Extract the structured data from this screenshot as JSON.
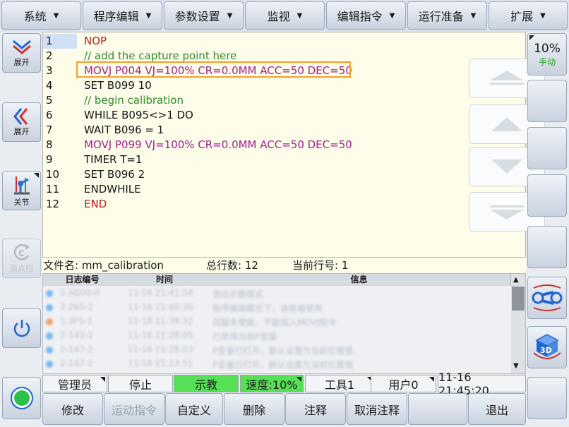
{
  "top_menu": [
    {
      "label": "系统"
    },
    {
      "label": "程序编辑"
    },
    {
      "label": "参数设置"
    },
    {
      "label": "监视"
    },
    {
      "label": "编辑指令"
    },
    {
      "label": "运行准备"
    },
    {
      "label": "扩展"
    }
  ],
  "left_sidebar": {
    "expand1": "展开",
    "expand2": "展开",
    "joint": "关节",
    "disabled": "原点归"
  },
  "right_sidebar": {
    "speed": "10%",
    "mode": "手动"
  },
  "program": {
    "lines": [
      {
        "num": "1",
        "text": "NOP",
        "color": "#b0202a"
      },
      {
        "num": "2",
        "text": "// add the capture point here",
        "color": "#2f8a2f"
      },
      {
        "num": "3",
        "text": "MOVJ P004 VJ=100% CR=0.0MM ACC=50 DEC=50",
        "color": "#a2208f"
      },
      {
        "num": "4",
        "text": "SET B099 10",
        "color": "#151515"
      },
      {
        "num": "5",
        "text": "// begin calibration",
        "color": "#2f8a2f"
      },
      {
        "num": "6",
        "text": "WHILE B095<>1 DO",
        "color": "#151515"
      },
      {
        "num": "7",
        "text": "WAIT B096 = 1",
        "color": "#151515"
      },
      {
        "num": "8",
        "text": "MOVJ P099 VJ=100% CR=0.0MM ACC=50 DEC=50",
        "color": "#a2208f"
      },
      {
        "num": "9",
        "text": "TIMER T=1",
        "color": "#151515"
      },
      {
        "num": "10",
        "text": "SET B096 2",
        "color": "#151515"
      },
      {
        "num": "11",
        "text": "ENDWHILE",
        "color": "#151515"
      },
      {
        "num": "12",
        "text": "END",
        "color": "#b0202a"
      }
    ]
  },
  "info_bar": {
    "filename": "文件名: mm_calibration",
    "total_lines": "总行数: 12",
    "current_line": "当前行号: 1"
  },
  "log": {
    "headers": [
      "日志编号",
      "时间",
      "信息"
    ],
    "rows": [
      {
        "id": "2-AD00-0",
        "time": "11-16 21:41:56",
        "msg": "退出示教模式"
      },
      {
        "id": "2-265-2",
        "time": "11-16 21:40:30",
        "msg": "程序编辑模式下，该处被禁用"
      },
      {
        "id": "1-3F5-1",
        "time": "11-16 21:38:32",
        "msg": "伺服未使能，不能插入MOVJ指令"
      },
      {
        "id": "2-143-2",
        "time": "11-16 21:28:05",
        "msg": "已禁用当前P变量"
      },
      {
        "id": "2-147-2",
        "time": "11-16 21:28:03",
        "msg": "P变量已打开，默认设置为当前位置值"
      },
      {
        "id": "2-147-2",
        "time": "11-16 21:23:51",
        "msg": "P变量已打开，默认设置为当前位置值"
      }
    ]
  },
  "status_bar": {
    "user_role": "管理员",
    "run_state": "停止",
    "mode": "示教",
    "speed": "速度:10%",
    "tool": "工具1",
    "user_frame": "用户0",
    "datetime": "11-16 21:45:20"
  },
  "bottom_buttons": [
    {
      "label": "修改"
    },
    {
      "label": "运动指令"
    },
    {
      "label": "自定义"
    },
    {
      "label": "删除"
    },
    {
      "label": "注释"
    },
    {
      "label": "取消注释"
    },
    {
      "label": ""
    },
    {
      "label": "退出"
    }
  ],
  "colors": {
    "editor_bg": "#fefde9",
    "highlight_box": "#f0a030",
    "mode_green": "#55e055",
    "keyword_red": "#b0202a",
    "comment_green": "#2f8a2f",
    "motion_purple": "#a2208f"
  }
}
